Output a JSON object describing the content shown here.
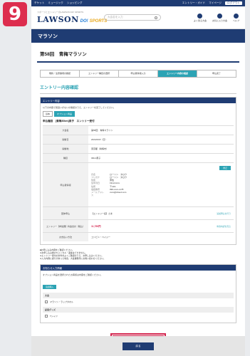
{
  "step_number": "9",
  "topbar": {
    "left_items": [
      "チケット",
      "ミュージック",
      "ショッピング"
    ],
    "right_items": [
      "エントリー・ガイド",
      "マイページ"
    ],
    "login": "ログアウト"
  },
  "header": {
    "tagline": "スポーツとエントリーのLAWSON DO! SPORTS",
    "logo_main": "LAWSON",
    "logo_do": "DO!",
    "logo_sports": "SPORTS",
    "search_placeholder": "大会名を入力",
    "icons": [
      {
        "name": "ranking-icon",
        "label": "よく見る大会"
      },
      {
        "name": "favorite-icon",
        "label": "お気に入り大会"
      },
      {
        "name": "help-icon",
        "label": "ヘルプ"
      }
    ]
  },
  "banner": "マラソン",
  "race_title": "第58回　青梅マラソン",
  "steps": [
    {
      "label": "規約・注意事項の確認",
      "active": false
    },
    {
      "label": "エントリー種目の選択",
      "active": false
    },
    {
      "label": "申込者情報入力",
      "active": false
    },
    {
      "label": "エントリー内容の確認",
      "active": true
    },
    {
      "label": "申込完了",
      "active": false
    }
  ],
  "section_title": "エントリー内容確認",
  "entry_box": {
    "head": "エントリー内容",
    "note": "以下の内容で間違いがないか確認のうえ、エントリーを完了してください。",
    "tabs": [
      "基本",
      "オプション商品"
    ],
    "event_name": "申込種目　[青梅30km]男子　エントリー受付",
    "rows": [
      {
        "label": "大会名",
        "value": "第58回　青梅マラソン"
      },
      {
        "label": "開催日",
        "value": "2024/2/18（日）"
      },
      {
        "label": "開催地",
        "value": "東京都（青梅市）"
      },
      {
        "label": "種目",
        "value": "30km男子"
      }
    ],
    "personal_label": "申込者情報",
    "personal_lines": [
      {
        "k": "氏名",
        "v": "ローソン　タロウ"
      },
      {
        "k": "フリガナ",
        "v": "ローソン　タロウ"
      },
      {
        "k": "性別",
        "v": "男性"
      },
      {
        "k": "生年月日",
        "v": "19xx/xx/xx"
      },
      {
        "k": "住所",
        "v": "〒140-"
      },
      {
        "k": "電話番号",
        "v": "090-xxxx-xx78"
      },
      {
        "k": "メールアドレス",
        "v": "xxxx@icloud.com"
      }
    ],
    "edit_label": "修正",
    "team_label": "団体申込",
    "team_value": "【エントリー名】さま",
    "team_link": "追加申込を行う",
    "fee_label": "エントリー【参加費】料金合計（税込）",
    "fee_value": "11,750円",
    "fee_link": "料金内訳を見る",
    "pay_label": "お支払い方法",
    "pay_value": "コンビニ・ペイジー"
  },
  "notes": [
    "■お申し込み内容をご確認ください。",
    "※お申し込み後のキャンセル・返金はできません。",
    "※エントリー受付の条件をよくご確認のうえ、お申し込みください。",
    "※入力内容に誤りがあった場合、大会事務局にお問い合わせください。"
  ],
  "option_box": {
    "head": "お知らせ入力情報",
    "note": "オプション商品を選択されたお客様は内容をご確認ください。",
    "button": "追加購入",
    "groups": [
      {
        "title": "大会",
        "item": "マラソン・ラップタオル"
      },
      {
        "title": "記念グッズ",
        "item": "Tシャツ"
      }
    ]
  },
  "confirm_button": "エントリー内容確定にする",
  "back_button": "戻る"
}
